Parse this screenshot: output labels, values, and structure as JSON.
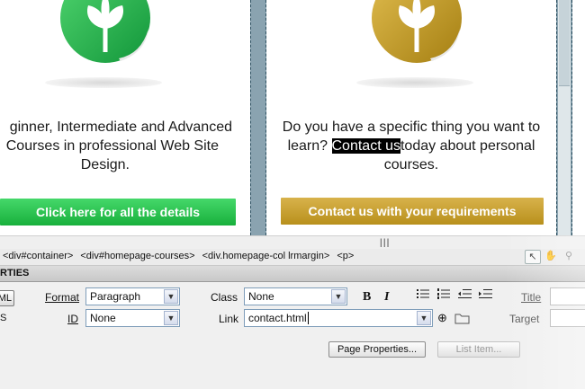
{
  "canvas": {
    "left_column": {
      "blurb_lines": [
        "ginner, Intermediate and Advanced",
        "Courses in professional Web Site",
        "Design."
      ],
      "button_label": "Click here for all the details",
      "logo_color": "#22b04b"
    },
    "right_column": {
      "blurb_line1": "Do you have a specific thing you want to",
      "blurb_line2_before": "learn?",
      "blurb_selected": "Contact us",
      "blurb_line2_after": "today about personal",
      "blurb_line3": "courses.",
      "button_label": "Contact us with your requirements",
      "logo_color": "#c9a227"
    }
  },
  "tag_selector": {
    "tags": [
      "<div#container>",
      "<div#homepage-courses>",
      "<div.homepage-col lrmargin>",
      "<p>"
    ]
  },
  "properties": {
    "tab_label": "RTIES",
    "html_label": "ML",
    "css_label": "S",
    "format_label": "Format",
    "format_value": "Paragraph",
    "id_label": "ID",
    "id_value": "None",
    "class_label": "Class",
    "class_value": "None",
    "link_label": "Link",
    "link_value": "contact.html",
    "title_label": "Title",
    "target_label": "Target",
    "bold_label": "B",
    "italic_label": "I",
    "page_properties_label": "Page Properties...",
    "list_item_label": "List Item..."
  }
}
